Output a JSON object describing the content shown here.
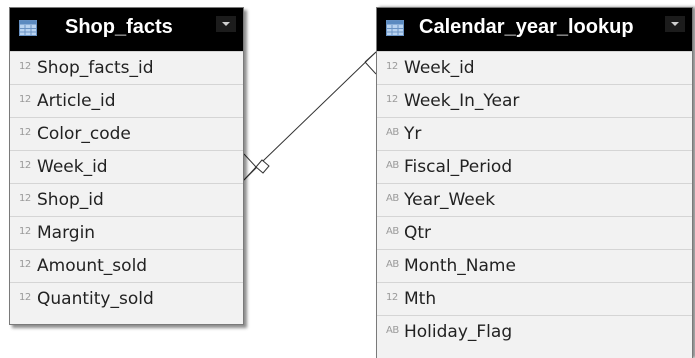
{
  "tables": [
    {
      "title": "Shop_facts",
      "fields": [
        {
          "type": "12",
          "name": "Shop_facts_id"
        },
        {
          "type": "12",
          "name": "Article_id"
        },
        {
          "type": "12",
          "name": "Color_code"
        },
        {
          "type": "12",
          "name": "Week_id"
        },
        {
          "type": "12",
          "name": "Shop_id"
        },
        {
          "type": "12",
          "name": "Margin"
        },
        {
          "type": "12",
          "name": "Amount_sold"
        },
        {
          "type": "12",
          "name": "Quantity_sold"
        }
      ]
    },
    {
      "title": "Calendar_year_lookup",
      "fields": [
        {
          "type": "12",
          "name": "Week_id"
        },
        {
          "type": "12",
          "name": "Week_In_Year"
        },
        {
          "type": "AB",
          "name": "Yr"
        },
        {
          "type": "AB",
          "name": "Fiscal_Period"
        },
        {
          "type": "AB",
          "name": "Year_Week"
        },
        {
          "type": "AB",
          "name": "Qtr"
        },
        {
          "type": "AB",
          "name": "Month_Name"
        },
        {
          "type": "12",
          "name": "Mth"
        },
        {
          "type": "AB",
          "name": "Holiday_Flag"
        }
      ]
    }
  ],
  "relationship": {
    "from": "Shop_facts.Week_id",
    "to": "Calendar_year_lookup.Week_id",
    "from_end": "many",
    "to_end": "one"
  },
  "colors": {
    "header_bg": "#000000",
    "header_text": "#ffffff",
    "row_bg": "#f2f2f2",
    "type_icon": "#9a9a9a",
    "line": "#333333"
  },
  "icons": {
    "table": "table-grid-icon",
    "dropdown": "chevron-down-icon"
  }
}
